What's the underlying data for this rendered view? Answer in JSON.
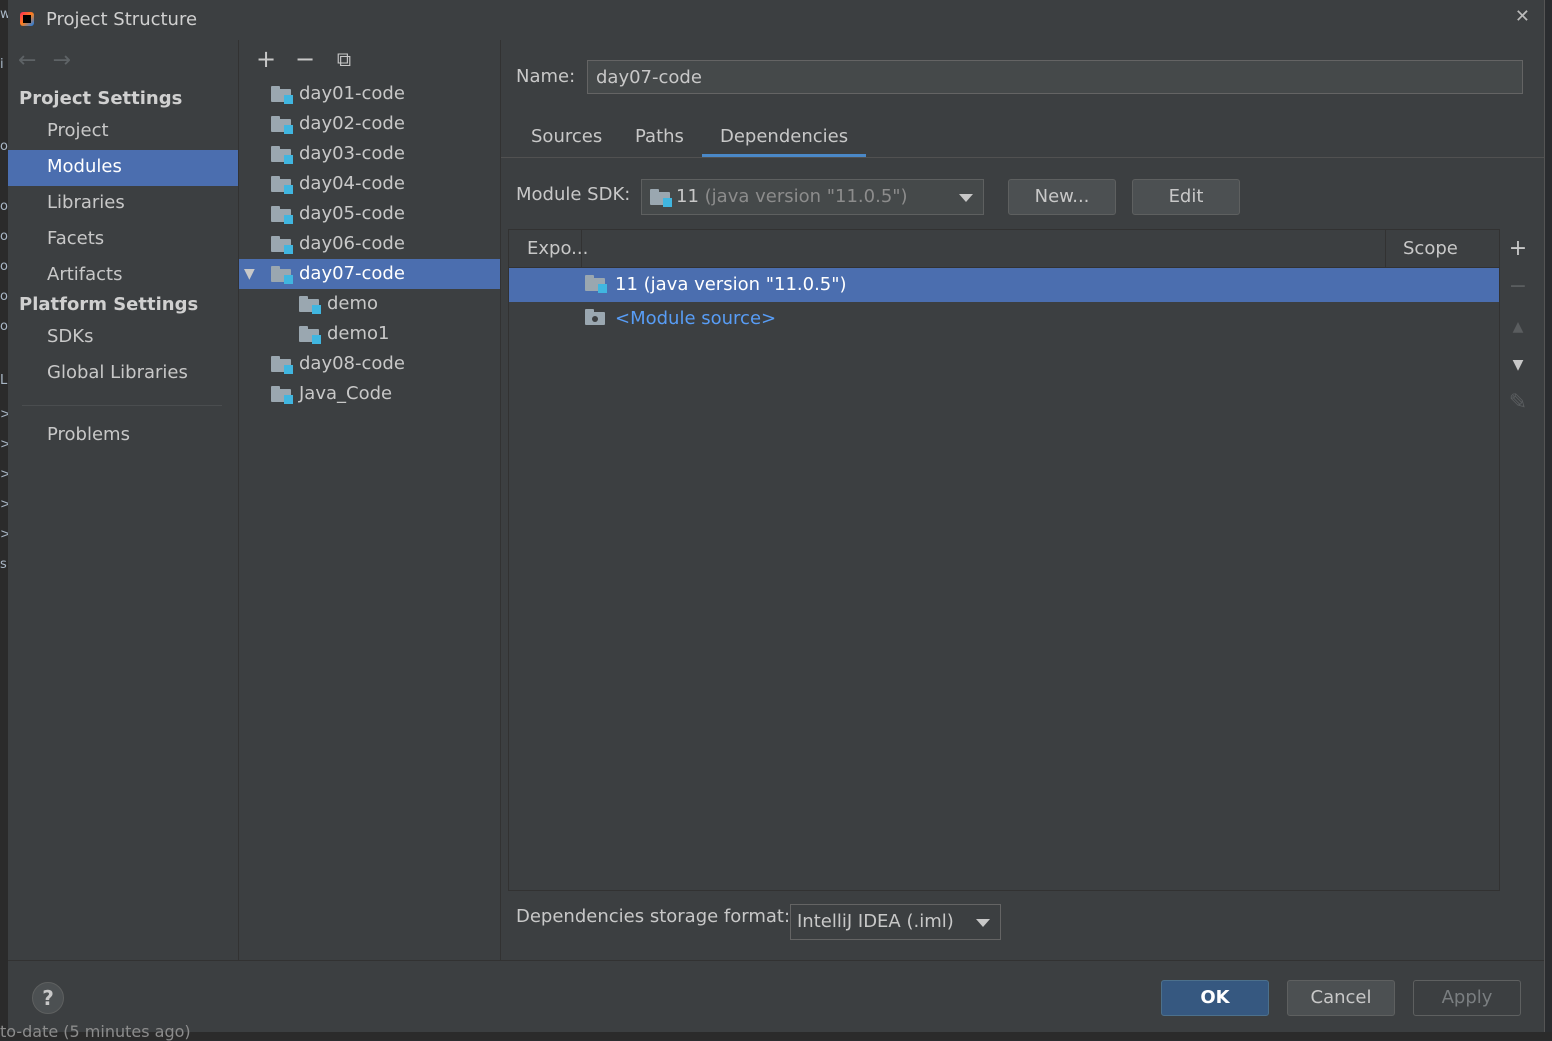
{
  "window": {
    "title": "Project Structure"
  },
  "ide_edge": {
    "left_chars": [
      "w",
      "i",
      "o",
      "o",
      "o",
      "o",
      "o",
      "o",
      "L",
      ">",
      ">",
      ">",
      ">",
      ">",
      "s"
    ],
    "bottom_text": "to-date (5 minutes ago)"
  },
  "sidebar": {
    "project_settings_heading": "Project Settings",
    "project_items": [
      "Project",
      "Modules",
      "Libraries",
      "Facets",
      "Artifacts"
    ],
    "platform_settings_heading": "Platform Settings",
    "platform_items": [
      "SDKs",
      "Global Libraries"
    ],
    "problems": "Problems",
    "selected": "Modules"
  },
  "module_tree": {
    "toolbar": {
      "add": "+",
      "remove": "−",
      "copy": "⧉"
    },
    "items": [
      {
        "label": "day01-code"
      },
      {
        "label": "day02-code"
      },
      {
        "label": "day03-code"
      },
      {
        "label": "day04-code"
      },
      {
        "label": "day05-code"
      },
      {
        "label": "day06-code"
      },
      {
        "label": "day07-code",
        "expanded": true,
        "selected": true
      },
      {
        "label": "demo",
        "child": true
      },
      {
        "label": "demo1",
        "child": true
      },
      {
        "label": "day08-code"
      },
      {
        "label": "Java_Code"
      }
    ]
  },
  "detail": {
    "name_label": "Name:",
    "name_value": "day07-code",
    "tabs": [
      "Sources",
      "Paths",
      "Dependencies"
    ],
    "active_tab": "Dependencies",
    "module_sdk_label": "Module SDK:",
    "sdk_version": "11",
    "sdk_detail": "(java version \"11.0.5\")",
    "new_button": "New...",
    "edit_button": "Edit",
    "table": {
      "col_export": "Expo...",
      "col_scope": "Scope",
      "rows": [
        {
          "text": "11 (java version \"11.0.5\")",
          "selected": true,
          "icon": "jdk-folder-icon"
        },
        {
          "text": "<Module source>",
          "selected": false,
          "icon": "module-source-folder-icon"
        }
      ]
    },
    "side_tools": {
      "add": "+",
      "remove": "−",
      "up": "▲",
      "down": "▼",
      "edit": "✎"
    },
    "storage_format_label": "Dependencies storage format:",
    "storage_format_value": "IntelliJ IDEA (.iml)"
  },
  "footer": {
    "help": "?",
    "ok": "OK",
    "cancel": "Cancel",
    "apply": "Apply"
  },
  "colors": {
    "selection": "#4b6eaf",
    "link": "#589df6",
    "ok_button": "#365880",
    "background": "#3c3f41"
  }
}
